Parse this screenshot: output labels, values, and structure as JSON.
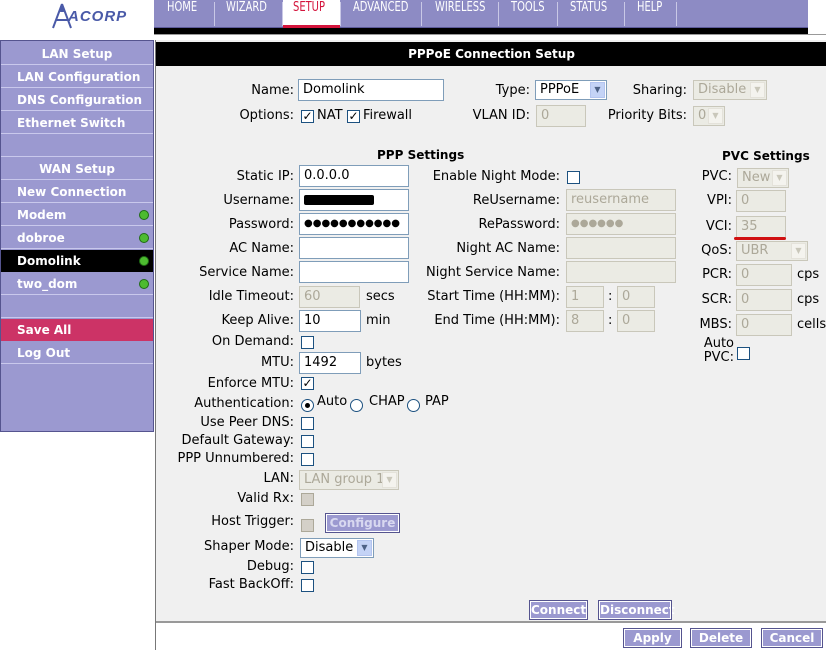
{
  "logo": {
    "text": "ACORP"
  },
  "topnav": {
    "items": [
      {
        "label": "HOME"
      },
      {
        "label": "WIZARD"
      },
      {
        "label": "SETUP"
      },
      {
        "label": "ADVANCED"
      },
      {
        "label": "WIRELESS"
      },
      {
        "label": "TOOLS"
      },
      {
        "label": "STATUS"
      },
      {
        "label": "HELP"
      }
    ],
    "active": "SETUP"
  },
  "sidebar": {
    "lan_header": "LAN Setup",
    "lan_items": [
      {
        "label": "LAN Configuration"
      },
      {
        "label": "DNS Configuration"
      },
      {
        "label": "Ethernet Switch"
      }
    ],
    "wan_header": "WAN Setup",
    "wan_items": [
      {
        "label": "New Connection"
      },
      {
        "label": "Modem"
      },
      {
        "label": "dobroe"
      },
      {
        "label": "Domolink"
      },
      {
        "label": "two_dom"
      }
    ],
    "save_all": "Save All",
    "log_out": "Log Out"
  },
  "page": {
    "title": "PPPoE Connection Setup"
  },
  "form": {
    "name_label": "Name:",
    "name_value": "Domolink",
    "type_label": "Type:",
    "type_value": "PPPoE",
    "sharing_label": "Sharing:",
    "sharing_value": "Disable",
    "options_label": "Options:",
    "nat_label": "NAT",
    "firewall_label": "Firewall",
    "vlan_label": "VLAN ID:",
    "vlan_value": "0",
    "priority_label": "Priority Bits:",
    "priority_value": "0"
  },
  "ppp": {
    "header": "PPP Settings",
    "static_ip_label": "Static IP:",
    "static_ip_value": "0.0.0.0",
    "username_label": "Username:",
    "password_label": "Password:",
    "password_value": "●●●●●●●●●●●",
    "ac_name_label": "AC Name:",
    "service_name_label": "Service Name:",
    "idle_timeout_label": "Idle Timeout:",
    "idle_timeout_value": "60",
    "idle_timeout_unit": "secs",
    "keep_alive_label": "Keep Alive:",
    "keep_alive_value": "10",
    "keep_alive_unit": "min",
    "on_demand_label": "On Demand:",
    "mtu_label": "MTU:",
    "mtu_value": "1492",
    "mtu_unit": "bytes",
    "enforce_mtu_label": "Enforce MTU:",
    "auth_label": "Authentication:",
    "auth_auto": "Auto",
    "auth_chap": "CHAP",
    "auth_pap": "PAP",
    "use_peer_dns_label": "Use Peer DNS:",
    "default_gateway_label": "Default Gateway:",
    "ppp_unnumbered_label": "PPP Unnumbered:",
    "lan_label": "LAN:",
    "lan_value": "LAN group 1",
    "valid_rx_label": "Valid Rx:",
    "host_trigger_label": "Host Trigger:",
    "configure_label": "Configure",
    "shaper_mode_label": "Shaper Mode:",
    "shaper_mode_value": "Disable",
    "debug_label": "Debug:",
    "fast_backoff_label": "Fast BackOff:"
  },
  "night": {
    "enable_label": "Enable Night Mode:",
    "reusername_label": "ReUsername:",
    "reusername_value": "reusername",
    "repassword_label": "RePassword:",
    "repassword_value": "●●●●●●",
    "night_ac_label": "Night AC Name:",
    "night_service_label": "Night Service Name:",
    "start_time_label": "Start Time (HH:MM):",
    "start_h": "1",
    "start_m": "0",
    "end_time_label": "End Time (HH:MM):",
    "end_h": "8",
    "end_m": "0",
    "colon": ":"
  },
  "pvc": {
    "header": "PVC Settings",
    "pvc_label": "PVC:",
    "pvc_value": "New",
    "vpi_label": "VPI:",
    "vpi_value": "0",
    "vci_label": "VCI:",
    "vci_value": "35",
    "qos_label": "QoS:",
    "qos_value": "UBR",
    "pcr_label": "PCR:",
    "pcr_value": "0",
    "pcr_unit": "cps",
    "scr_label": "SCR:",
    "scr_value": "0",
    "scr_unit": "cps",
    "mbs_label": "MBS:",
    "mbs_value": "0",
    "mbs_unit": "cells",
    "auto_pvc_label_1": "Auto",
    "auto_pvc_label_2": "PVC:"
  },
  "actions": {
    "connect": "Connect",
    "disconnect": "Disconnect",
    "apply": "Apply",
    "delete": "Delete",
    "cancel": "Cancel"
  },
  "colors": {
    "nav": "#8d8bc4",
    "sidebar": "#9b99d0",
    "accent": "#d4143c",
    "save": "#cc3366",
    "status_dot": "#4dbb30"
  }
}
